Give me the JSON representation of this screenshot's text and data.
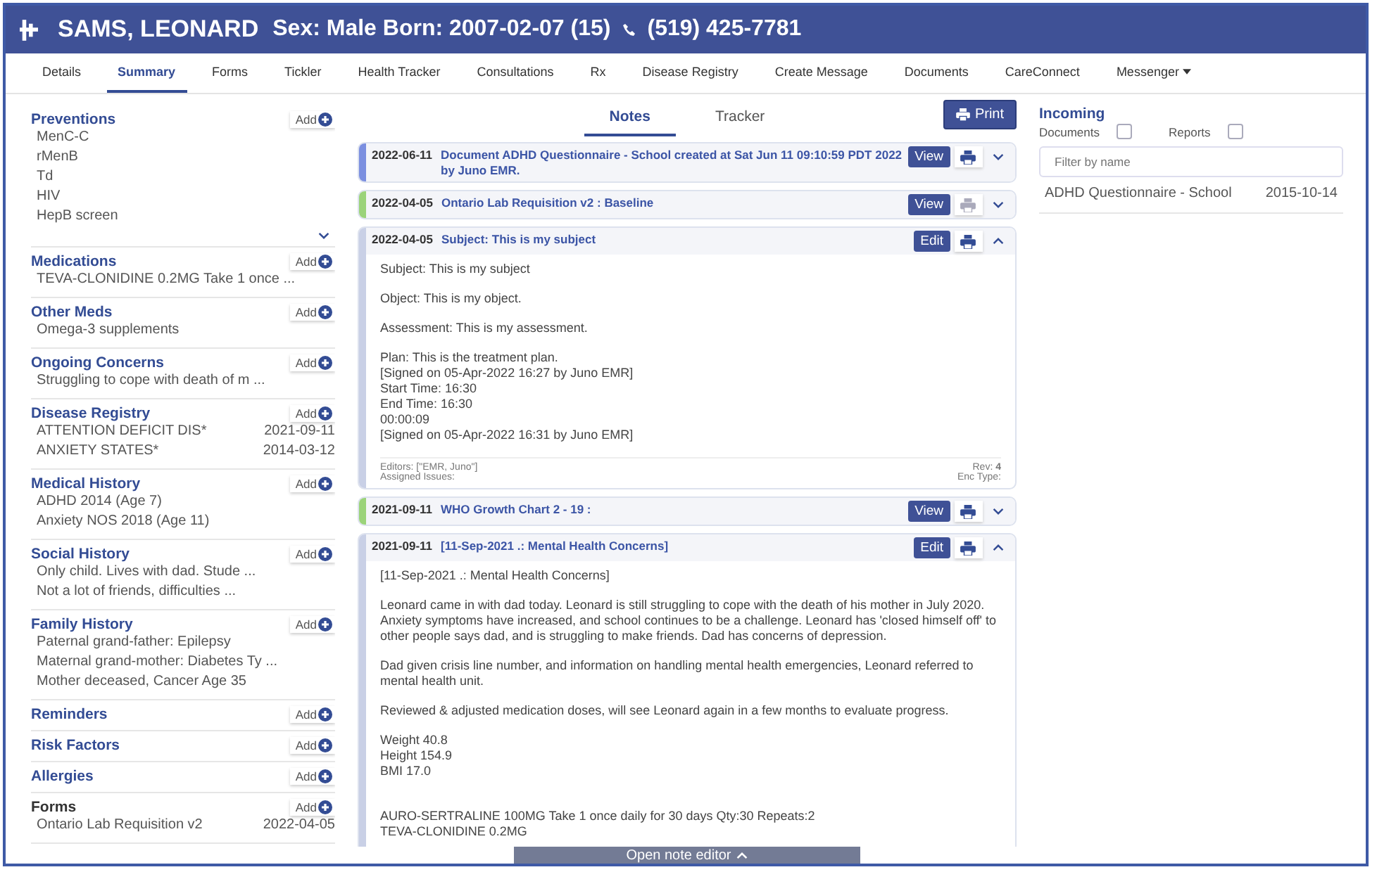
{
  "header": {
    "name": "SAMS, LEONARD",
    "details": "Sex: Male Born: 2007-02-07 (15)",
    "phone": "(519) 425-7781"
  },
  "tabs": [
    {
      "label": "Details",
      "selected": false,
      "menu": false
    },
    {
      "label": "Summary",
      "selected": true,
      "menu": false
    },
    {
      "label": "Forms",
      "selected": false,
      "menu": false
    },
    {
      "label": "Tickler",
      "selected": false,
      "menu": false
    },
    {
      "label": "Health Tracker",
      "selected": false,
      "menu": false
    },
    {
      "label": "Consultations",
      "selected": false,
      "menu": false
    },
    {
      "label": "Rx",
      "selected": false,
      "menu": false
    },
    {
      "label": "Disease Registry",
      "selected": false,
      "menu": false
    },
    {
      "label": "Create Message",
      "selected": false,
      "menu": false
    },
    {
      "label": "Documents",
      "selected": false,
      "menu": false
    },
    {
      "label": "CareConnect",
      "selected": false,
      "menu": false
    },
    {
      "label": "Messenger",
      "selected": false,
      "menu": true
    }
  ],
  "sections": [
    {
      "title": "Preventions",
      "kind": "accent",
      "add": "Add",
      "more": true,
      "items": [
        {
          "text": "MenC-C"
        },
        {
          "text": "rMenB"
        },
        {
          "text": "Td"
        },
        {
          "text": "HIV"
        },
        {
          "text": "HepB screen"
        }
      ]
    },
    {
      "title": "Medications",
      "kind": "accent",
      "add": "Add",
      "items": [
        {
          "text": "TEVA-CLONIDINE 0.2MG Take 1 once ..."
        }
      ]
    },
    {
      "title": "Other Meds",
      "kind": "accent",
      "add": "Add",
      "items": [
        {
          "text": "Omega-3 supplements"
        }
      ]
    },
    {
      "title": "Ongoing Concerns",
      "kind": "accent",
      "add": "Add",
      "items": [
        {
          "text": "Struggling to cope with death of m ..."
        }
      ]
    },
    {
      "title": "Disease Registry",
      "kind": "accent",
      "add": "Add",
      "items": [
        {
          "text": "ATTENTION DEFICIT DIS*",
          "date": "2021-09-11"
        },
        {
          "text": "ANXIETY STATES*",
          "date": "2014-03-12"
        }
      ]
    },
    {
      "title": "Medical History",
      "kind": "accent",
      "add": "Add",
      "items": [
        {
          "text": "ADHD 2014 (Age 7)"
        },
        {
          "text": "Anxiety NOS 2018 (Age 11)"
        }
      ]
    },
    {
      "title": "Social History",
      "kind": "accent",
      "add": "Add",
      "items": [
        {
          "text": "Only child. Lives with dad. Stude ..."
        },
        {
          "text": "Not a lot of friends, difficulties ..."
        }
      ]
    },
    {
      "title": "Family History",
      "kind": "accent",
      "add": "Add",
      "items": [
        {
          "text": "Paternal grand-father: Epilepsy"
        },
        {
          "text": "Maternal grand-mother: Diabetes Ty ..."
        },
        {
          "text": "Mother deceased, Cancer Age 35"
        }
      ]
    },
    {
      "title": "Reminders",
      "kind": "accent",
      "add": "Add"
    },
    {
      "title": "Risk Factors",
      "kind": "accent",
      "add": "Add"
    },
    {
      "title": "Allergies",
      "kind": "accent",
      "add": "Add"
    },
    {
      "title": "Forms",
      "kind": "plain",
      "add": "Add",
      "items": [
        {
          "text": "Ontario Lab Requisition v2",
          "date": "2022-04-05"
        }
      ]
    }
  ],
  "note_tabs": [
    {
      "label": "Notes",
      "selected": true
    },
    {
      "label": "Tracker",
      "selected": false
    }
  ],
  "print_button": "Print",
  "notes": [
    {
      "date": "2022-06-11",
      "title": "Document ADHD Questionnaire - School created at Sat Jun 11 09:10:59 PDT 2022 by Juno EMR.",
      "color": "#7b8fe0",
      "action": "View",
      "print_enabled": true,
      "expanded": false
    },
    {
      "date": "2022-04-05",
      "title": "Ontario Lab Requisition v2 : Baseline",
      "color": "#9bd37a",
      "action": "View",
      "print_enabled": false,
      "expanded": false
    },
    {
      "date": "2022-04-05",
      "title": "Subject: This is my subject",
      "color": "#c9d0e6",
      "action": "Edit",
      "print_enabled": true,
      "expanded": true,
      "body": [
        "Subject: This is my subject",
        "Object: This is my object.",
        "Assessment:  This is my assessment.",
        "Plan: This is the treatment plan.\n[Signed on 05-Apr-2022 16:27 by Juno EMR]\nStart Time: 16:30\nEnd Time: 16:30\n00:00:09\n[Signed on 05-Apr-2022 16:31 by Juno EMR]"
      ],
      "footer": {
        "editors": "Editors: [\"EMR, Juno\"]",
        "issues": "Assigned Issues:",
        "rev": "Rev: **4**",
        "enc": "Enc Type:"
      }
    },
    {
      "date": "2021-09-11",
      "title": "WHO Growth Chart 2 - 19 :",
      "color": "#9bd37a",
      "action": "View",
      "print_enabled": true,
      "expanded": false
    },
    {
      "date": "2021-09-11",
      "title": "[11-Sep-2021 .: Mental Health Concerns]",
      "color": "#c9d0e6",
      "action": "Edit",
      "print_enabled": true,
      "expanded": true,
      "body": [
        "[11-Sep-2021 .: Mental Health Concerns]",
        "Leonard came in with dad today. Leonard is still struggling to cope with the death of his mother in July 2020. Anxiety symptoms have increased, and school continues to be a challenge. Leonard has 'closed himself off' to other people says dad, and is struggling to make friends. Dad has concerns of depression.",
        "Dad given crisis line number, and information on handling mental health emergencies, Leonard referred to mental health unit.",
        "Reviewed & adjusted medication doses, will see Leonard again in a few months to evaluate progress.",
        "Weight 40.8\nHeight 154.9\nBMI 17.0\n\n",
        "AURO-SERTRALINE 100MG  Take 1 once daily for 30 days  Qty:30 Repeats:2\nTEVA-CLONIDINE 0.2MG"
      ]
    }
  ],
  "editor_bar": "Open note editor",
  "incoming": {
    "title": "Incoming",
    "filters": [
      {
        "label": "Documents",
        "checked": false
      },
      {
        "label": "Reports",
        "checked": false
      }
    ],
    "placeholder": "Filter by name",
    "items": [
      {
        "name": "ADHD Questionnaire - School",
        "date": "2015-10-14"
      }
    ]
  }
}
